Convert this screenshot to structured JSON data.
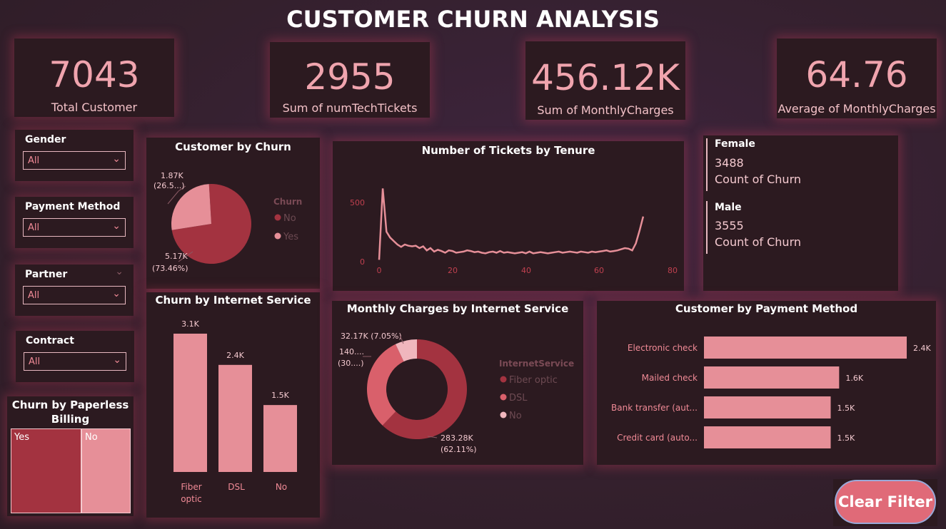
{
  "title": "CUSTOMER CHURN ANALYSIS",
  "kpis": [
    {
      "value": "7043",
      "label": "Total Customer"
    },
    {
      "value": "2955",
      "label": "Sum of numTechTickets"
    },
    {
      "value": "456.12K",
      "label": "Sum of MonthlyCharges"
    },
    {
      "value": "64.76",
      "label": "Average of MonthlyCharges"
    }
  ],
  "slicers": [
    {
      "title": "Gender",
      "value": "All"
    },
    {
      "title": "Payment Method",
      "value": "All"
    },
    {
      "title": "Partner",
      "value": "All"
    },
    {
      "title": "Contract",
      "value": "All"
    }
  ],
  "icons": {
    "chevron": "chevron-down-icon"
  },
  "colors": {
    "dark_red": "#a33340",
    "mid_red": "#d9606b",
    "light_pink": "#e68f98",
    "pale_pink": "#f0b6bd",
    "accent": "#e06a78"
  },
  "churn_pie": {
    "title": "Customer by Churn",
    "legend_title": "Churn",
    "legend_no": "No",
    "legend_yes": "Yes",
    "label_yes_1": "1.87K",
    "label_yes_2": "(26.5...)",
    "label_no_1": "5.17K",
    "label_no_2": "(73.46%)"
  },
  "tenure_chart": {
    "title": "Number of Tickets by Tenure",
    "y_ticks": [
      "500",
      "0"
    ],
    "x_ticks": [
      "0",
      "20",
      "40",
      "60",
      "80"
    ]
  },
  "gender_card": {
    "female_label": "Female",
    "female_value": "3488",
    "female_caption": "Count of Churn",
    "male_label": "Male",
    "male_value": "3555",
    "male_caption": "Count of Churn"
  },
  "internet_bar": {
    "title": "Churn by Internet Service",
    "bars": [
      {
        "label1": "Fiber",
        "label2": "optic",
        "value_label": "3.1K"
      },
      {
        "label1": "DSL",
        "label2": "",
        "value_label": "2.4K"
      },
      {
        "label1": "No",
        "label2": "",
        "value_label": "1.5K"
      }
    ]
  },
  "charges_donut": {
    "title": "Monthly Charges by Internet Service",
    "legend_title": "InternetService",
    "legend_items": [
      "Fiber optic",
      "DSL",
      "No"
    ],
    "label_no": "32.17K (7.05%)",
    "label_dsl_1": "140....",
    "label_dsl_2": "(30....)",
    "label_fiber_1": "283.28K",
    "label_fiber_2": "(62.11%)"
  },
  "payment_bar": {
    "title": "Customer by Payment Method",
    "bars": [
      {
        "label": "Electronic check",
        "value_label": "2.4K"
      },
      {
        "label": "Mailed check",
        "value_label": "1.6K"
      },
      {
        "label": "Bank transfer (aut...",
        "value_label": "1.5K"
      },
      {
        "label": "Credit card (auto...",
        "value_label": "1.5K"
      }
    ]
  },
  "paperless": {
    "title_1": "Churn by Paperless",
    "title_2": "Billing",
    "yes": "Yes",
    "no": "No"
  },
  "clear_button": "Clear Filter",
  "chart_data": [
    {
      "type": "pie",
      "title": "Customer by Churn",
      "categories": [
        "No",
        "Yes"
      ],
      "values": [
        5170,
        1870
      ],
      "percent": [
        73.46,
        26.54
      ]
    },
    {
      "type": "line",
      "title": "Number of Tickets by Tenure",
      "x": [
        0,
        1,
        2,
        3,
        4,
        5,
        6,
        7,
        8,
        9,
        10,
        11,
        12,
        13,
        14,
        15,
        16,
        17,
        18,
        19,
        20,
        21,
        22,
        23,
        24,
        25,
        26,
        27,
        28,
        29,
        30,
        31,
        32,
        33,
        34,
        35,
        36,
        37,
        38,
        39,
        40,
        41,
        42,
        43,
        44,
        45,
        46,
        47,
        48,
        49,
        50,
        51,
        52,
        53,
        54,
        55,
        56,
        57,
        58,
        59,
        60,
        61,
        62,
        63,
        64,
        65,
        66,
        67,
        68,
        69,
        70,
        71,
        72
      ],
      "values": [
        10,
        620,
        250,
        200,
        170,
        140,
        120,
        140,
        130,
        125,
        130,
        110,
        125,
        90,
        110,
        80,
        95,
        85,
        70,
        90,
        85,
        70,
        75,
        80,
        90,
        85,
        75,
        80,
        70,
        65,
        75,
        80,
        70,
        85,
        70,
        75,
        70,
        65,
        70,
        75,
        65,
        80,
        65,
        70,
        75,
        70,
        65,
        70,
        75,
        80,
        70,
        75,
        80,
        75,
        70,
        80,
        75,
        70,
        80,
        75,
        80,
        85,
        90,
        80,
        85,
        90,
        100,
        110,
        105,
        90,
        150,
        260,
        380
      ],
      "ylim": [
        0,
        650
      ],
      "xlim": [
        0,
        80
      ]
    },
    {
      "type": "bar",
      "title": "Churn by Internet Service",
      "categories": [
        "Fiber optic",
        "DSL",
        "No"
      ],
      "values": [
        3100,
        2400,
        1500
      ]
    },
    {
      "type": "pie",
      "title": "Monthly Charges by Internet Service",
      "categories": [
        "Fiber optic",
        "DSL",
        "No"
      ],
      "values": [
        283280,
        140670,
        32170
      ],
      "percent": [
        62.11,
        30.84,
        7.05
      ]
    },
    {
      "type": "bar",
      "title": "Customer by Payment Method",
      "categories": [
        "Electronic check",
        "Mailed check",
        "Bank transfer (aut...",
        "Credit card (auto..."
      ],
      "values": [
        2400,
        1600,
        1500,
        1500
      ]
    },
    {
      "type": "table",
      "title": "Churn by Paperless Billing",
      "categories": [
        "Yes",
        "No"
      ],
      "values": [
        4170,
        2870
      ]
    }
  ]
}
